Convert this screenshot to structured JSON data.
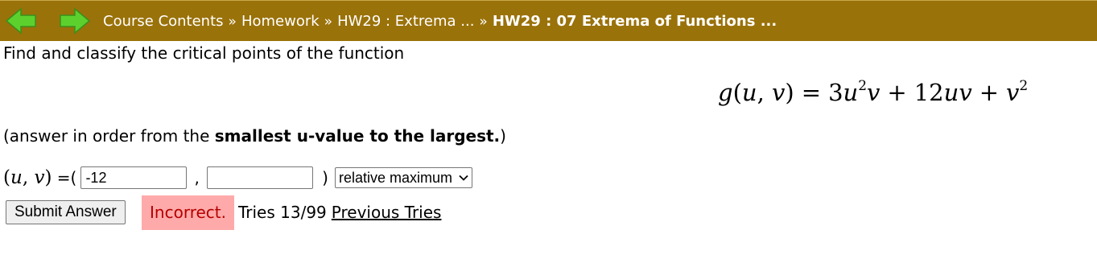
{
  "nav": {
    "breadcrumbs": [
      {
        "label": "Course Contents"
      },
      {
        "label": "Homework"
      },
      {
        "label": "HW29 : Extrema ..."
      }
    ],
    "separator": "»",
    "current": "HW29 : 07 Extrema of Functions ...",
    "arrow_color": "#5cd12e"
  },
  "problem": {
    "prompt": "Find and classify the critical points of the function",
    "formula": {
      "lhs_fn": "g",
      "lhs_open": "(",
      "lhs_u": "u",
      "lhs_comma": ", ",
      "lhs_v": "v",
      "lhs_close": ")",
      "equals": "=",
      "t1_coef": "3",
      "t1_u": "u",
      "t1_exp": "2",
      "t1_v": "v",
      "plus1": "+",
      "t2_coef": "12",
      "t2_uv": "uv",
      "plus2": "+",
      "t3_v": "v",
      "t3_exp": "2"
    },
    "order_note_prefix": "(answer in order from the ",
    "order_note_bold": "smallest u-value to the largest.",
    "order_note_suffix": ")"
  },
  "answer": {
    "label_open": "(",
    "label_u": "u",
    "label_comma": ", ",
    "label_v": "v",
    "label_close": ")",
    "equals_paren": " =(",
    "u_value": "-12",
    "comma": ",",
    "v_value": "",
    "close_paren": ")",
    "classification": "relative maximum"
  },
  "submission": {
    "submit_label": "Submit Answer",
    "status": "Incorrect.",
    "tries_text": "Tries 13/99",
    "previous_tries_label": "Previous Tries",
    "status_bg": "#ffaaaa",
    "status_color": "#b40000"
  },
  "colors": {
    "topbar": "#9a720a"
  }
}
